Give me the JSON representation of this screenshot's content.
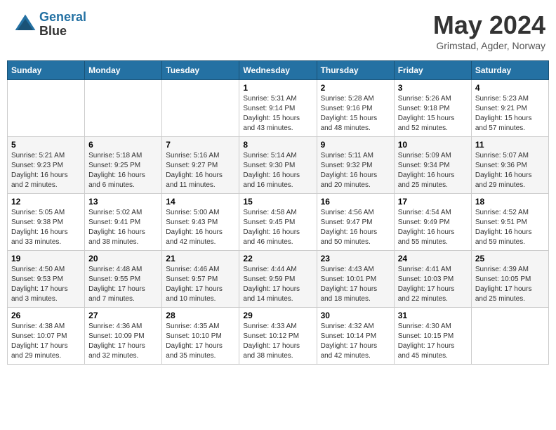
{
  "header": {
    "logo_line1": "General",
    "logo_line2": "Blue",
    "month_year": "May 2024",
    "location": "Grimstad, Agder, Norway"
  },
  "weekdays": [
    "Sunday",
    "Monday",
    "Tuesday",
    "Wednesday",
    "Thursday",
    "Friday",
    "Saturday"
  ],
  "weeks": [
    [
      {
        "day": "",
        "info": ""
      },
      {
        "day": "",
        "info": ""
      },
      {
        "day": "",
        "info": ""
      },
      {
        "day": "1",
        "info": "Sunrise: 5:31 AM\nSunset: 9:14 PM\nDaylight: 15 hours\nand 43 minutes."
      },
      {
        "day": "2",
        "info": "Sunrise: 5:28 AM\nSunset: 9:16 PM\nDaylight: 15 hours\nand 48 minutes."
      },
      {
        "day": "3",
        "info": "Sunrise: 5:26 AM\nSunset: 9:18 PM\nDaylight: 15 hours\nand 52 minutes."
      },
      {
        "day": "4",
        "info": "Sunrise: 5:23 AM\nSunset: 9:21 PM\nDaylight: 15 hours\nand 57 minutes."
      }
    ],
    [
      {
        "day": "5",
        "info": "Sunrise: 5:21 AM\nSunset: 9:23 PM\nDaylight: 16 hours\nand 2 minutes."
      },
      {
        "day": "6",
        "info": "Sunrise: 5:18 AM\nSunset: 9:25 PM\nDaylight: 16 hours\nand 6 minutes."
      },
      {
        "day": "7",
        "info": "Sunrise: 5:16 AM\nSunset: 9:27 PM\nDaylight: 16 hours\nand 11 minutes."
      },
      {
        "day": "8",
        "info": "Sunrise: 5:14 AM\nSunset: 9:30 PM\nDaylight: 16 hours\nand 16 minutes."
      },
      {
        "day": "9",
        "info": "Sunrise: 5:11 AM\nSunset: 9:32 PM\nDaylight: 16 hours\nand 20 minutes."
      },
      {
        "day": "10",
        "info": "Sunrise: 5:09 AM\nSunset: 9:34 PM\nDaylight: 16 hours\nand 25 minutes."
      },
      {
        "day": "11",
        "info": "Sunrise: 5:07 AM\nSunset: 9:36 PM\nDaylight: 16 hours\nand 29 minutes."
      }
    ],
    [
      {
        "day": "12",
        "info": "Sunrise: 5:05 AM\nSunset: 9:38 PM\nDaylight: 16 hours\nand 33 minutes."
      },
      {
        "day": "13",
        "info": "Sunrise: 5:02 AM\nSunset: 9:41 PM\nDaylight: 16 hours\nand 38 minutes."
      },
      {
        "day": "14",
        "info": "Sunrise: 5:00 AM\nSunset: 9:43 PM\nDaylight: 16 hours\nand 42 minutes."
      },
      {
        "day": "15",
        "info": "Sunrise: 4:58 AM\nSunset: 9:45 PM\nDaylight: 16 hours\nand 46 minutes."
      },
      {
        "day": "16",
        "info": "Sunrise: 4:56 AM\nSunset: 9:47 PM\nDaylight: 16 hours\nand 50 minutes."
      },
      {
        "day": "17",
        "info": "Sunrise: 4:54 AM\nSunset: 9:49 PM\nDaylight: 16 hours\nand 55 minutes."
      },
      {
        "day": "18",
        "info": "Sunrise: 4:52 AM\nSunset: 9:51 PM\nDaylight: 16 hours\nand 59 minutes."
      }
    ],
    [
      {
        "day": "19",
        "info": "Sunrise: 4:50 AM\nSunset: 9:53 PM\nDaylight: 17 hours\nand 3 minutes."
      },
      {
        "day": "20",
        "info": "Sunrise: 4:48 AM\nSunset: 9:55 PM\nDaylight: 17 hours\nand 7 minutes."
      },
      {
        "day": "21",
        "info": "Sunrise: 4:46 AM\nSunset: 9:57 PM\nDaylight: 17 hours\nand 10 minutes."
      },
      {
        "day": "22",
        "info": "Sunrise: 4:44 AM\nSunset: 9:59 PM\nDaylight: 17 hours\nand 14 minutes."
      },
      {
        "day": "23",
        "info": "Sunrise: 4:43 AM\nSunset: 10:01 PM\nDaylight: 17 hours\nand 18 minutes."
      },
      {
        "day": "24",
        "info": "Sunrise: 4:41 AM\nSunset: 10:03 PM\nDaylight: 17 hours\nand 22 minutes."
      },
      {
        "day": "25",
        "info": "Sunrise: 4:39 AM\nSunset: 10:05 PM\nDaylight: 17 hours\nand 25 minutes."
      }
    ],
    [
      {
        "day": "26",
        "info": "Sunrise: 4:38 AM\nSunset: 10:07 PM\nDaylight: 17 hours\nand 29 minutes."
      },
      {
        "day": "27",
        "info": "Sunrise: 4:36 AM\nSunset: 10:09 PM\nDaylight: 17 hours\nand 32 minutes."
      },
      {
        "day": "28",
        "info": "Sunrise: 4:35 AM\nSunset: 10:10 PM\nDaylight: 17 hours\nand 35 minutes."
      },
      {
        "day": "29",
        "info": "Sunrise: 4:33 AM\nSunset: 10:12 PM\nDaylight: 17 hours\nand 38 minutes."
      },
      {
        "day": "30",
        "info": "Sunrise: 4:32 AM\nSunset: 10:14 PM\nDaylight: 17 hours\nand 42 minutes."
      },
      {
        "day": "31",
        "info": "Sunrise: 4:30 AM\nSunset: 10:15 PM\nDaylight: 17 hours\nand 45 minutes."
      },
      {
        "day": "",
        "info": ""
      }
    ]
  ]
}
